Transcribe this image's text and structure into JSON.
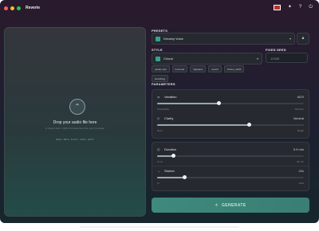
{
  "app": {
    "title": "Reverie"
  },
  "titlebar": {
    "traffic_lights": [
      "#ff5f57",
      "#febc2e",
      "#28c840"
    ],
    "icons": [
      "flag-icon",
      "bug-icon",
      "help-icon",
      "power-icon"
    ]
  },
  "dropzone": {
    "title": "Drop your audio file here",
    "subtitle": "or drag & drop / click to browse files from your computer",
    "formats": "WAV, MP3, FLAC, OGG, AIFF"
  },
  "presets": {
    "label": "PRESETS",
    "selected": "Dreamy Voice",
    "thumb_color": "#3aa090"
  },
  "style": {
    "label": "STYLE",
    "selected": "Choral",
    "thumb_color": "#3aa090",
    "tags": [
      "pastel-mist",
      "hummed",
      "highpass",
      "reverb",
      "chorus_width",
      "stretching"
    ]
  },
  "seed": {
    "label": "FIXED SEED",
    "placeholder": "12345"
  },
  "parameters": {
    "label": "PARAMETERS",
    "variation": {
      "label": "Variation",
      "value": "ADS",
      "left": "Predictable",
      "right": "Random",
      "level": 0.42
    },
    "clarity": {
      "label": "Clarity",
      "value": "Neutral",
      "left": "Dark",
      "right": "Bright",
      "level": 0.63
    },
    "duration": {
      "label": "Duration",
      "value": "5.5 min",
      "left": "0 min",
      "right": "30 min",
      "level": 0.11
    },
    "stretch": {
      "label": "Stretch",
      "value": "20x",
      "left": "1x",
      "right": "100x",
      "level": 0.19
    }
  },
  "generate": {
    "label": "GENERATE"
  }
}
